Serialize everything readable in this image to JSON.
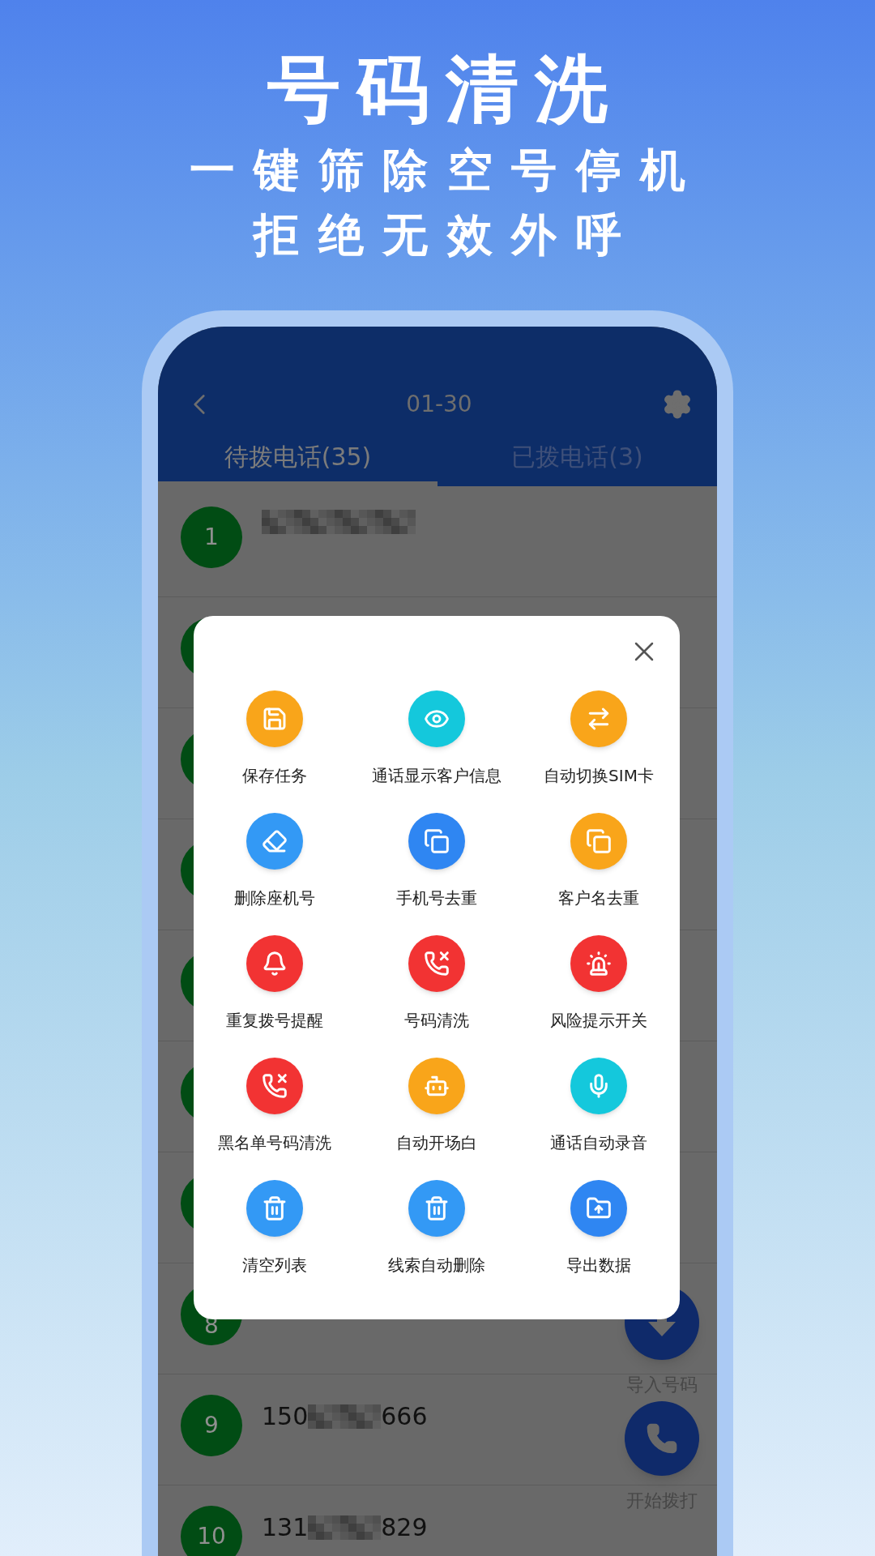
{
  "headline": {
    "title": "号码清洗",
    "lines": [
      "一键筛除空号停机",
      "拒绝无效外呼"
    ]
  },
  "app_bar": {
    "title": "01-30"
  },
  "tabs": [
    {
      "label": "待拨电话(35)",
      "selected": true
    },
    {
      "label": "已拨电话(3)",
      "selected": false
    }
  ],
  "rows": [
    {
      "kind": "entry",
      "index": "1",
      "redacted": true
    },
    {
      "kind": "covered"
    },
    {
      "kind": "covered"
    },
    {
      "kind": "covered"
    },
    {
      "kind": "covered"
    },
    {
      "kind": "covered"
    },
    {
      "kind": "covered"
    },
    {
      "kind": "covered",
      "index": "8"
    },
    {
      "kind": "entry",
      "index": "9",
      "number_start": "150",
      "redacted": true,
      "number_end": "666"
    },
    {
      "kind": "entry",
      "index": "10",
      "number_start": "131",
      "redacted": true,
      "number_end": "829"
    }
  ],
  "dialog": {
    "items": [
      {
        "label": "保存任务",
        "color": "#f9a51a"
      },
      {
        "label": "通话显示客户信息",
        "color": "#14c8dc"
      },
      {
        "label": "自动切换SIM卡",
        "color": "#f9a51a"
      },
      {
        "label": "删除座机号",
        "color": "#3399f5"
      },
      {
        "label": "手机号去重",
        "color": "#2f86f2"
      },
      {
        "label": "客户名去重",
        "color": "#f9a51a"
      },
      {
        "label": "重复拨号提醒",
        "color": "#f23333"
      },
      {
        "label": "号码清洗",
        "color": "#f23333"
      },
      {
        "label": "风险提示开关",
        "color": "#f23333"
      },
      {
        "label": "黑名单号码清洗",
        "color": "#f23333"
      },
      {
        "label": "自动开场白",
        "color": "#f9a51a"
      },
      {
        "label": "通话自动录音",
        "color": "#14c8dc"
      },
      {
        "label": "清空列表",
        "color": "#3399f5"
      },
      {
        "label": "线索自动删除",
        "color": "#3399f5"
      },
      {
        "label": "导出数据",
        "color": "#2f86f2"
      }
    ]
  },
  "actions": [
    {
      "label": "导入号码"
    },
    {
      "label": "开始拨打"
    }
  ]
}
